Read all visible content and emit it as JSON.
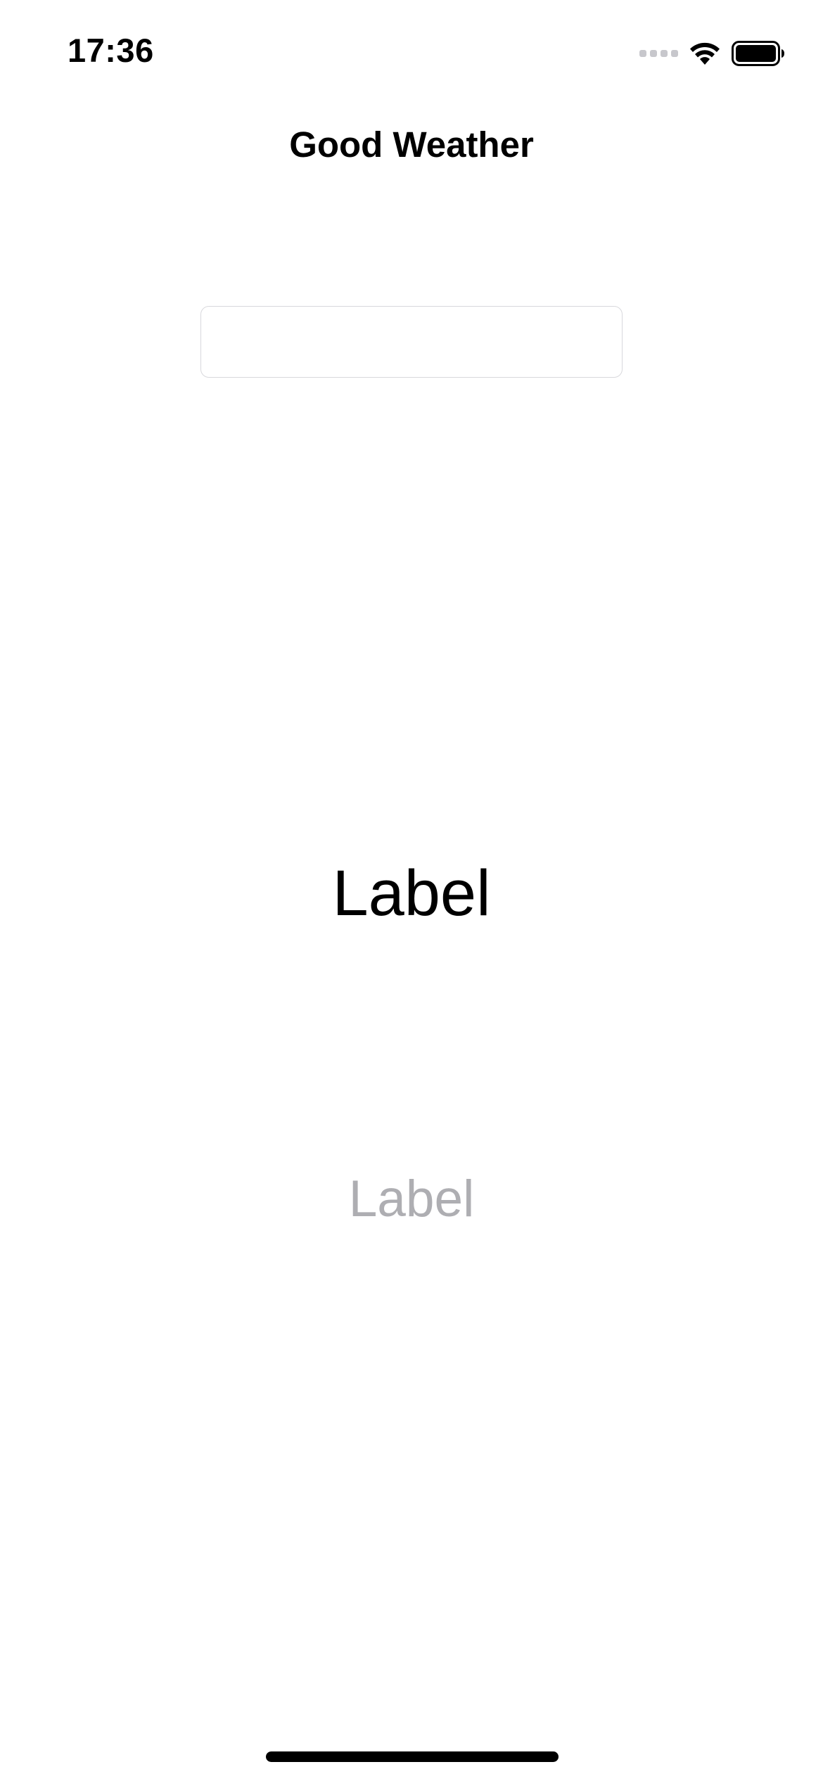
{
  "status_bar": {
    "time": "17:36",
    "icons": [
      "cellular-signal-icon",
      "wifi-icon",
      "battery-icon"
    ]
  },
  "nav": {
    "title": "Good Weather"
  },
  "city_input": {
    "value": "",
    "placeholder": ""
  },
  "labels": {
    "temperature": "Label",
    "humidity": "Label"
  },
  "colors": {
    "background": "#ffffff",
    "primary_text": "#000000",
    "secondary_text": "#aeaeb2",
    "input_border": "#d8d8dc"
  }
}
